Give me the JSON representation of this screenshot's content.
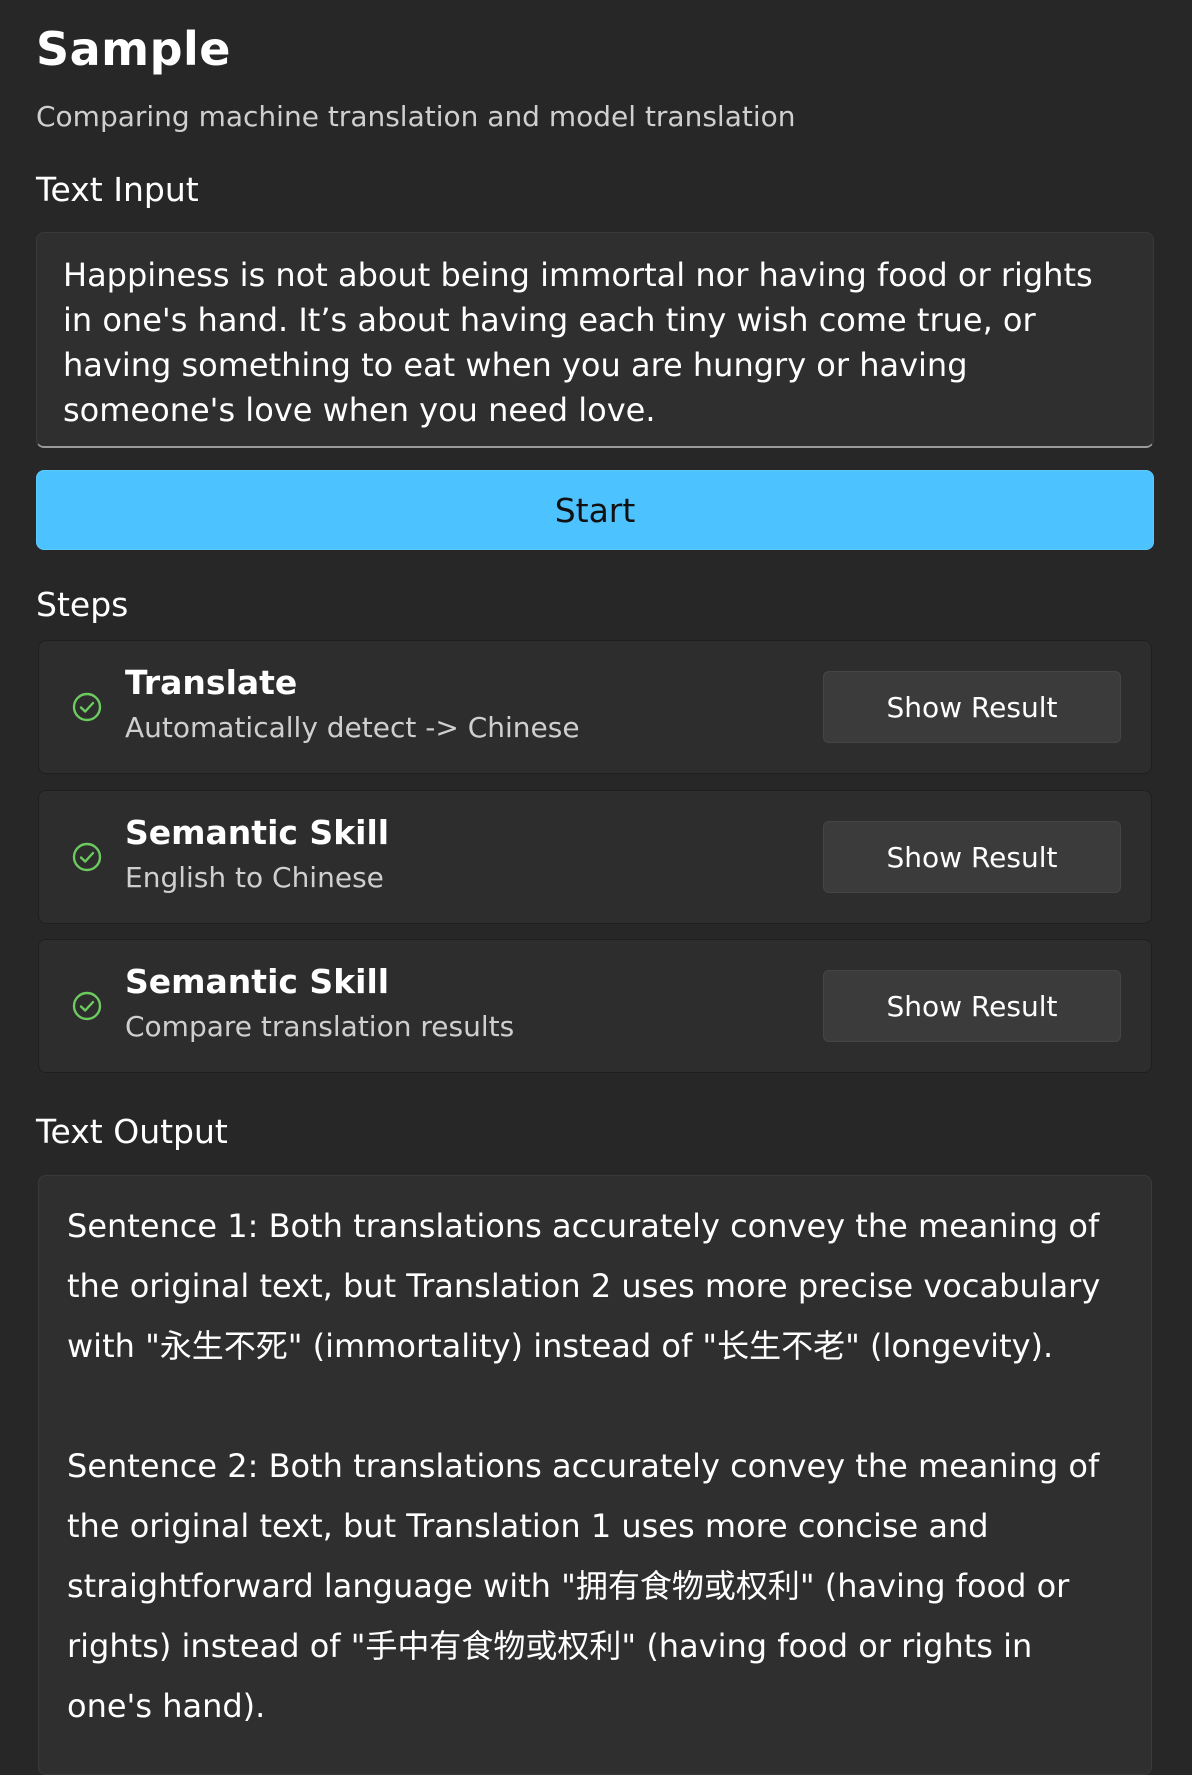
{
  "header": {
    "title": "Sample",
    "subtitle": "Comparing machine translation and model translation"
  },
  "input": {
    "label": "Text Input",
    "value": "Happiness is not about being immortal nor having food or rights in one's hand. It’s about having each tiny wish come true, or having something to eat when you are hungry or having someone's love when you need love."
  },
  "start_button": {
    "label": "Start",
    "color": "#4cc2ff"
  },
  "steps": {
    "label": "Steps",
    "items": [
      {
        "title": "Translate",
        "description": "Automatically detect -> Chinese",
        "status": "check-circle-icon",
        "button_label": "Show Result"
      },
      {
        "title": "Semantic Skill",
        "description": "English to Chinese",
        "status": "check-circle-icon",
        "button_label": "Show Result"
      },
      {
        "title": "Semantic Skill",
        "description": "Compare translation results",
        "status": "check-circle-icon",
        "button_label": "Show Result"
      }
    ],
    "check_color": "#6ccb5f"
  },
  "output": {
    "label": "Text Output",
    "paragraphs": [
      "Sentence 1: Both translations accurately convey the meaning of the original text, but Translation 2 uses more precise vocabulary with \"永生不死\" (immortality) instead of \"长生不老\" (longevity).",
      "Sentence 2: Both translations accurately convey the meaning of the original text, but Translation 1 uses more concise and straightforward language with \"拥有食物或权利\" (having food or rights) instead of \"手中有食物或权利\" (having food or rights in one's hand)."
    ]
  }
}
